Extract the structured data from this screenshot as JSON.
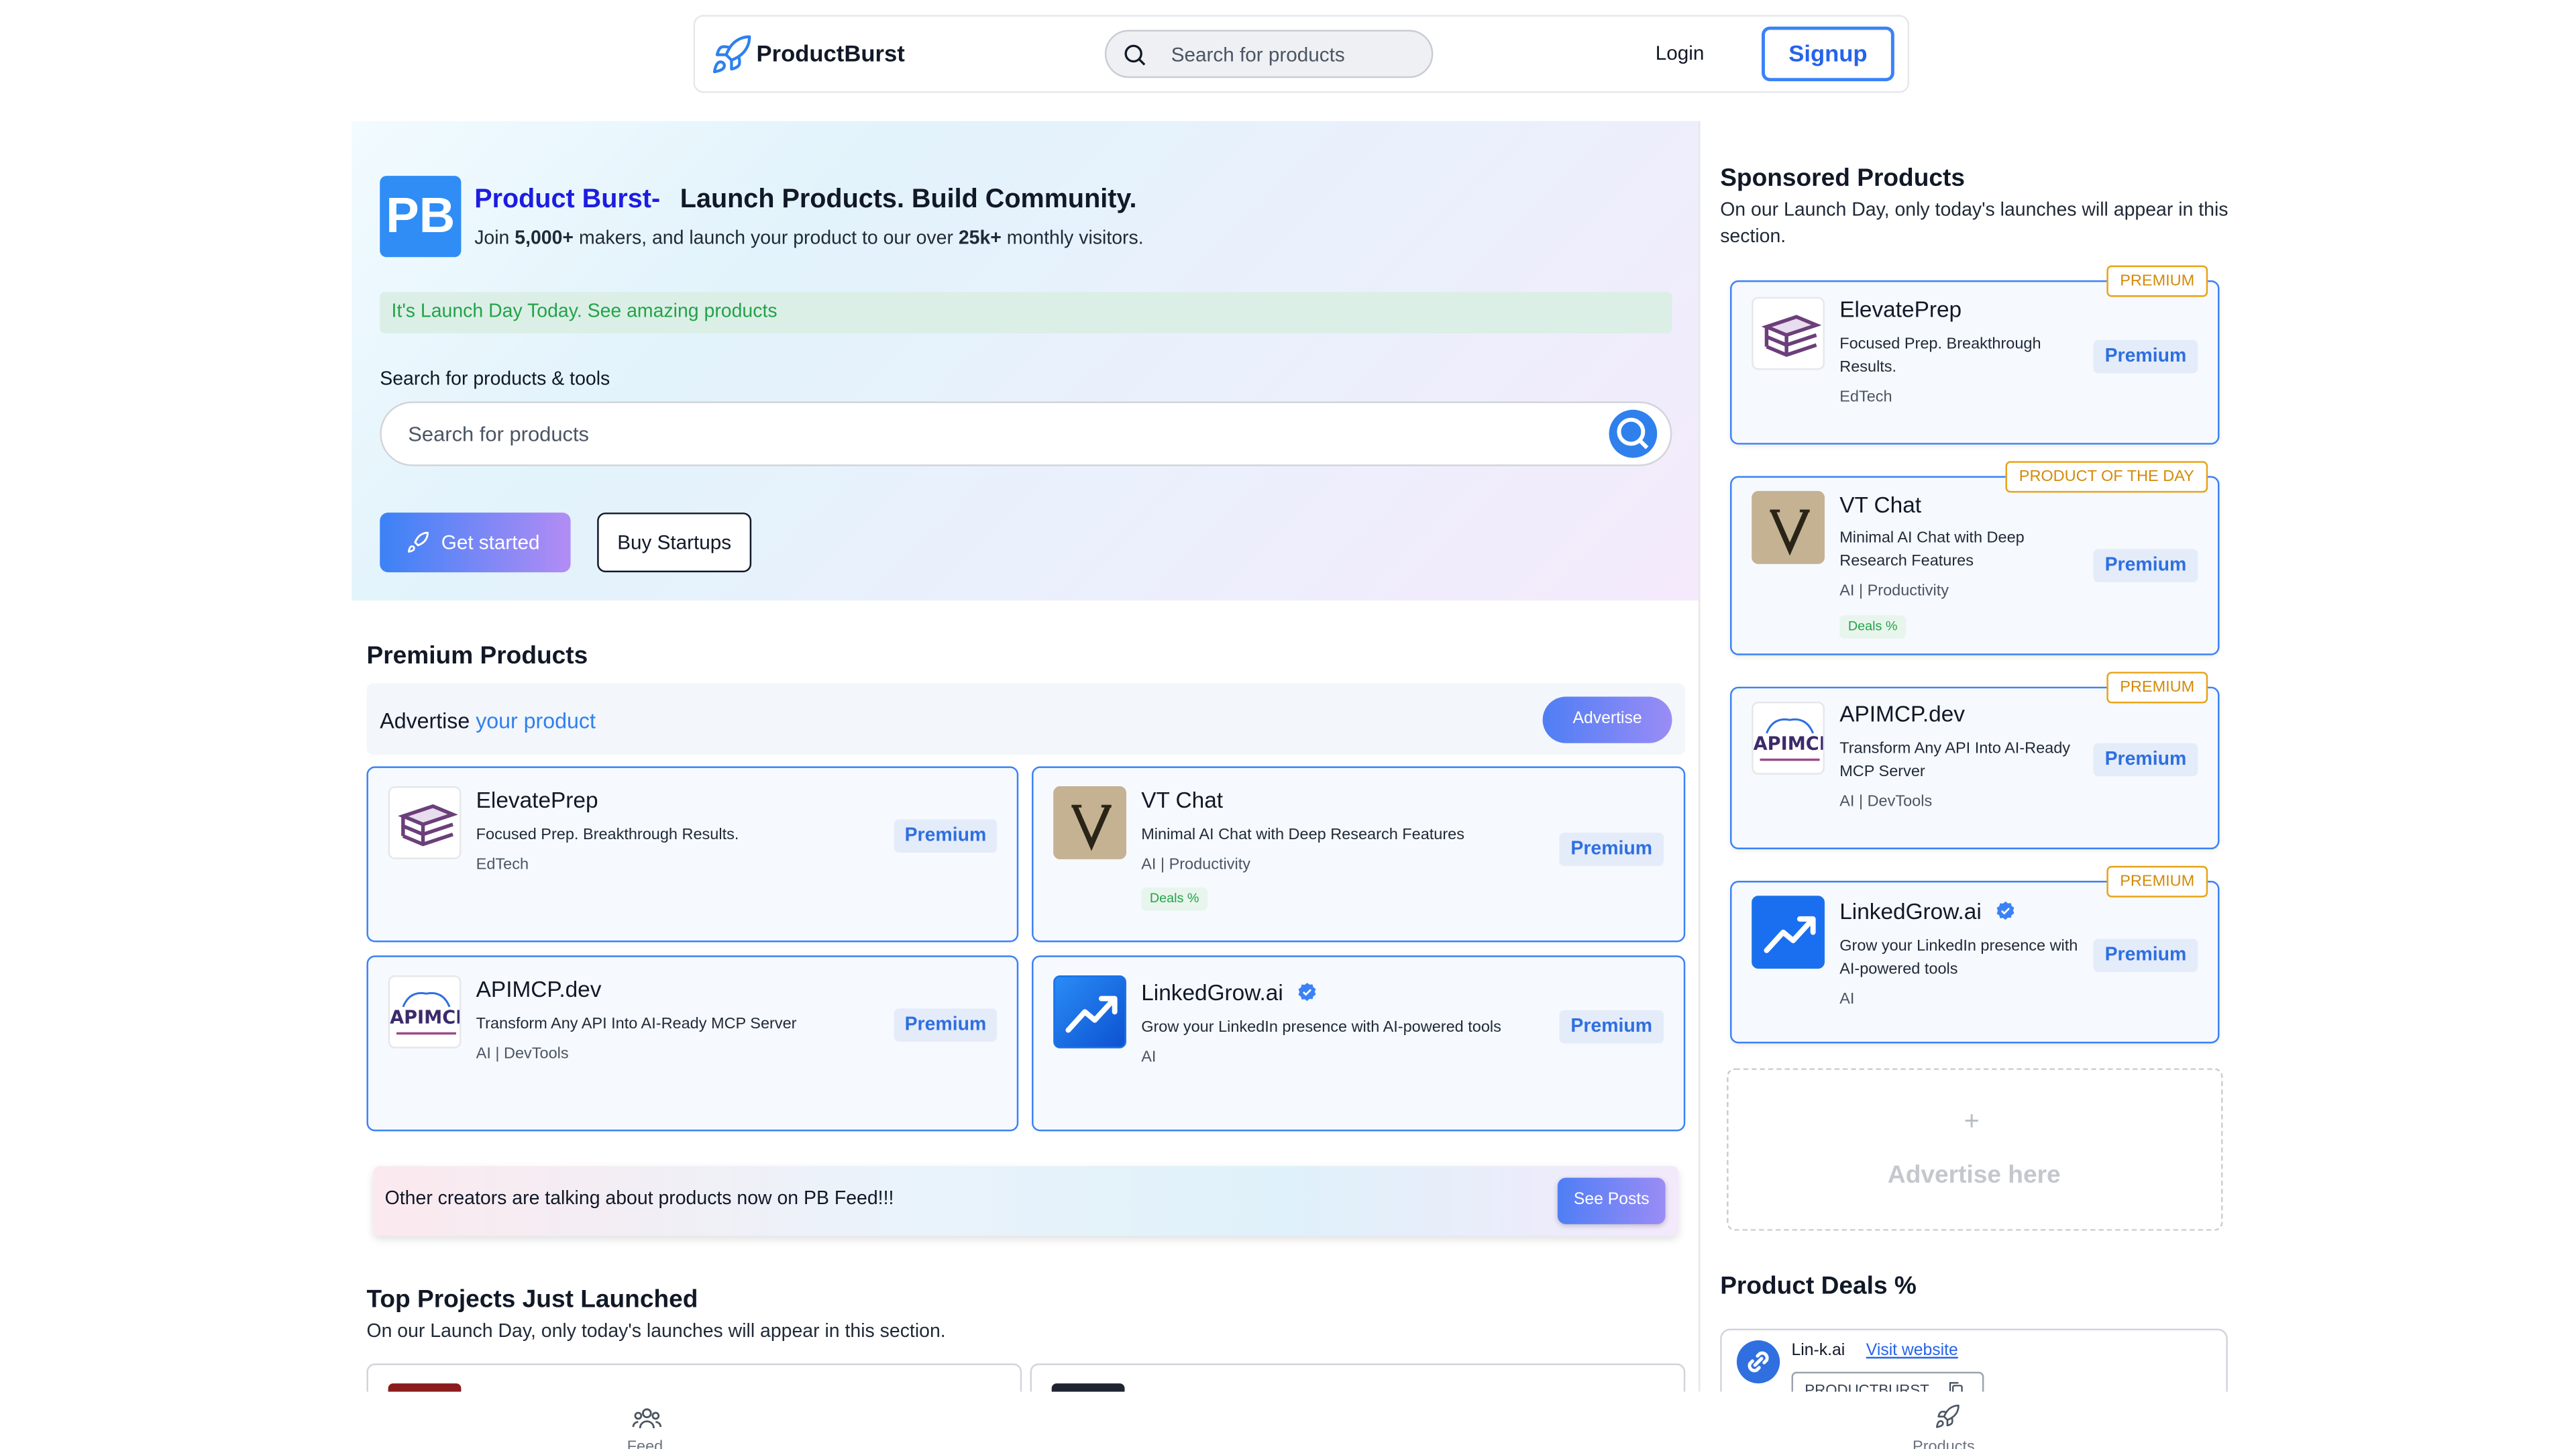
{
  "nav": {
    "brand": "ProductBurst",
    "search_placeholder": "Search for products",
    "login": "Login",
    "signup": "Signup"
  },
  "hero": {
    "logo_text": "PB",
    "brand": "Product Burst-",
    "tagline": "Launch Products. Build Community.",
    "sub_prefix": "Join ",
    "sub_makers": "5,000+",
    "sub_mid": " makers, and launch your product to our over ",
    "sub_visitors": "25k+",
    "sub_suffix": " monthly visitors.",
    "launch_banner": "It's Launch Day Today. See amazing products",
    "search_label": "Search for products & tools",
    "search_placeholder": "Search for products",
    "get_started": "Get started",
    "buy_startups": "Buy Startups"
  },
  "premium": {
    "heading": "Premium Products",
    "advertise_prefix": "Advertise ",
    "advertise_highlight": "your product",
    "advertise_button": "Advertise",
    "badge": "Premium",
    "products": [
      {
        "name": "ElevatePrep",
        "desc": "Focused Prep. Breakthrough Results.",
        "category": "EdTech"
      },
      {
        "name": "VT Chat",
        "desc": "Minimal AI Chat with Deep Research Features",
        "category": "AI | Productivity",
        "deal": "Deals %"
      },
      {
        "name": "APIMCP.dev",
        "desc": "Transform Any API Into AI-Ready MCP Server",
        "category": "AI | DevTools"
      },
      {
        "name": "LinkedGrow.ai",
        "desc": "Grow your LinkedIn presence with AI-powered tools",
        "category": "AI"
      }
    ]
  },
  "feed": {
    "text": "Other creators are talking about products now on PB Feed!!!",
    "button": "See Posts"
  },
  "top_projects": {
    "heading": "Top Projects Just Launched",
    "sub": "On our Launch Day, only today's launches will appear in this section."
  },
  "sidebar": {
    "heading": "Sponsored Products",
    "sub": "On our Launch Day, only today's launches will appear in this section.",
    "badge": "Premium",
    "cards": [
      {
        "ribbon": "PREMIUM",
        "name": "ElevatePrep",
        "desc": "Focused Prep. Breakthrough Results.",
        "category": "EdTech"
      },
      {
        "ribbon": "PRODUCT OF THE DAY",
        "name": "VT Chat",
        "desc": "Minimal AI Chat with Deep Research Features",
        "category": "AI | Productivity",
        "deal": "Deals %"
      },
      {
        "ribbon": "PREMIUM",
        "name": "APIMCP.dev",
        "desc": "Transform Any API Into AI-Ready MCP Server",
        "category": "AI | DevTools"
      },
      {
        "ribbon": "PREMIUM",
        "name": "LinkedGrow.ai",
        "desc": "Grow your LinkedIn presence with AI-powered tools",
        "category": "AI"
      }
    ],
    "advertise_plus": "+",
    "advertise_here": "Advertise here",
    "deals_heading": "Product Deals %",
    "deal": {
      "name": "Lin-k.ai",
      "link": "Visit website",
      "code": "PRODUCTBURST"
    }
  },
  "bottom_nav": {
    "feed": "Feed",
    "products": "Products"
  },
  "colors": {
    "accent": "#3b82f6",
    "brand_blue": "#1d1ce0",
    "ribbon": "#e8a317",
    "success": "#22a34a"
  },
  "icons": [
    "rocket-icon",
    "search-icon",
    "verified-icon",
    "link-icon",
    "copy-icon",
    "users-icon"
  ]
}
